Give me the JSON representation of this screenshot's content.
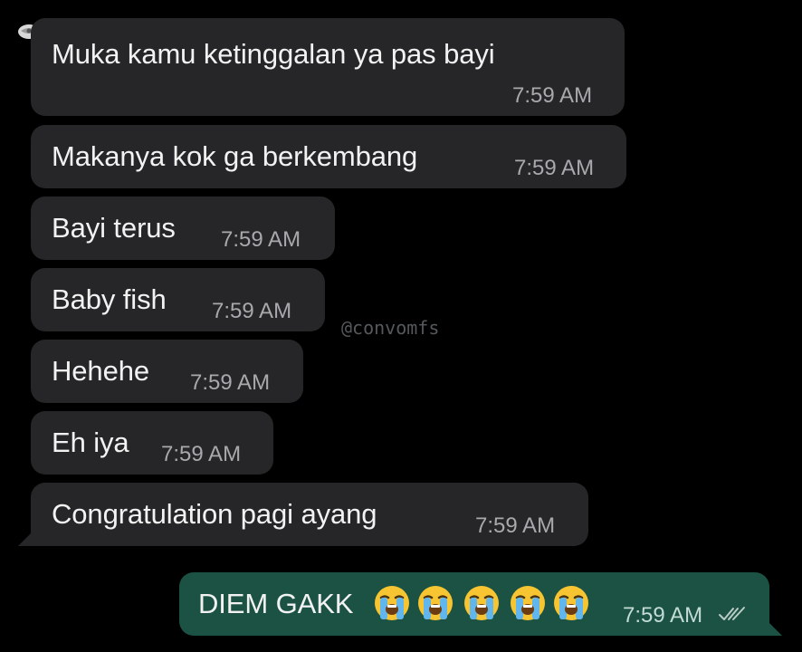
{
  "messages": [
    {
      "text": "Muka kamu ketinggalan ya pas bayi",
      "time": "7:59 AM"
    },
    {
      "text": "Makanya kok ga berkembang",
      "time": "7:59 AM"
    },
    {
      "text": "Bayi terus",
      "time": "7:59 AM"
    },
    {
      "text": "Baby fish",
      "time": "7:59 AM"
    },
    {
      "text": "Hehehe",
      "time": "7:59 AM"
    },
    {
      "text": "Eh iya",
      "time": "7:59 AM"
    },
    {
      "text": "Congratulation pagi ayang",
      "time": "7:59 AM"
    }
  ],
  "reply": {
    "text": "DIEM GAKK",
    "emoji": "loudly-crying-face",
    "emoji_count": 5,
    "time": "7:59 AM",
    "status": "read"
  },
  "watermark": "@convomfs",
  "colors": {
    "incoming": "#262628",
    "outgoing": "#1c5244",
    "background": "#000000"
  }
}
